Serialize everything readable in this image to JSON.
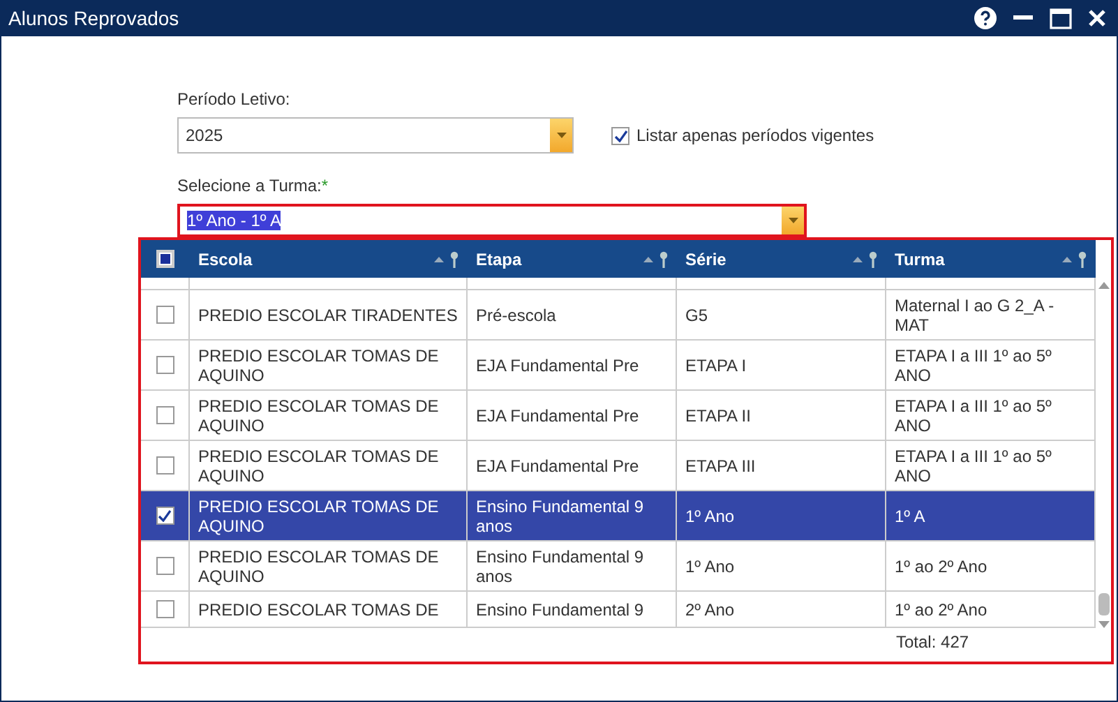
{
  "window": {
    "title": "Alunos Reprovados"
  },
  "periodo": {
    "label": "Período Letivo:",
    "value": "2025"
  },
  "vigentes": {
    "label": "Listar apenas períodos vigentes",
    "checked": true
  },
  "turma": {
    "label": "Selecione a Turma:",
    "required_mark": "*",
    "value": "1º Ano - 1º A"
  },
  "table": {
    "all_checked": false,
    "columns": [
      "Escola",
      "Etapa",
      "Série",
      "Turma"
    ],
    "rows": [
      {
        "selected": false,
        "cells": [
          "PREDIO ESCOLAR TIRADENTES",
          "Pré-escola",
          "G5",
          "Maternal I ao G 2_A - MAT"
        ]
      },
      {
        "selected": false,
        "cells": [
          "PREDIO ESCOLAR TOMAS DE AQUINO",
          "EJA Fundamental Pre",
          "ETAPA I",
          "ETAPA I a III 1º ao 5º ANO"
        ]
      },
      {
        "selected": false,
        "cells": [
          "PREDIO ESCOLAR TOMAS DE AQUINO",
          "EJA Fundamental Pre",
          "ETAPA II",
          "ETAPA I a III 1º ao 5º ANO"
        ]
      },
      {
        "selected": false,
        "cells": [
          "PREDIO ESCOLAR TOMAS DE AQUINO",
          "EJA Fundamental Pre",
          "ETAPA III",
          "ETAPA I a III 1º ao 5º ANO"
        ]
      },
      {
        "selected": true,
        "cells": [
          "PREDIO ESCOLAR TOMAS DE AQUINO",
          "Ensino Fundamental 9 anos",
          "1º Ano",
          "1º A"
        ]
      },
      {
        "selected": false,
        "cells": [
          "PREDIO ESCOLAR TOMAS DE AQUINO",
          "Ensino Fundamental 9 anos",
          "1º Ano",
          "1º ao 2º Ano"
        ]
      },
      {
        "selected": false,
        "cut": true,
        "cells": [
          "PREDIO ESCOLAR TOMAS DE",
          "Ensino Fundamental 9",
          "2º Ano",
          "1º ao 2º Ano"
        ]
      }
    ],
    "total": "Total: 427"
  }
}
